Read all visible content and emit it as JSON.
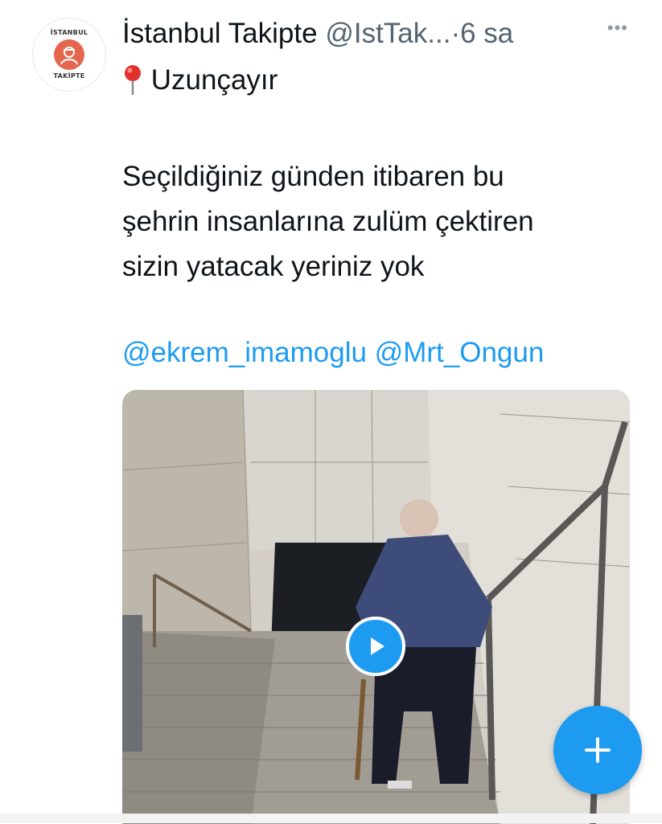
{
  "tweet": {
    "author": {
      "name": "İstanbul Takipte",
      "handle": "@IstTak...",
      "avatar_text_top": "İSTANBUL",
      "avatar_text_bottom": "TAKİPTE"
    },
    "separator": "·",
    "time": "6 sa",
    "more_icon": "more-dots-icon",
    "location": {
      "icon": "pin-icon",
      "label": "Uzunçayır"
    },
    "text_lines": [
      "Seçildiğiniz günden itibaren bu",
      "şehrin insanlarına zulüm çektiren",
      "sizin yatacak yeriniz yok"
    ],
    "mentions": [
      "@ekrem_imamoglu",
      "@Mrt_Ongun"
    ],
    "media": {
      "type": "video",
      "play_icon": "play-icon"
    }
  },
  "compose_button": {
    "icon": "plus-icon"
  },
  "colors": {
    "accent": "#1d9bf0",
    "text": "#0f1419",
    "secondary": "#536471",
    "avatar_brand": "#e4664f"
  }
}
